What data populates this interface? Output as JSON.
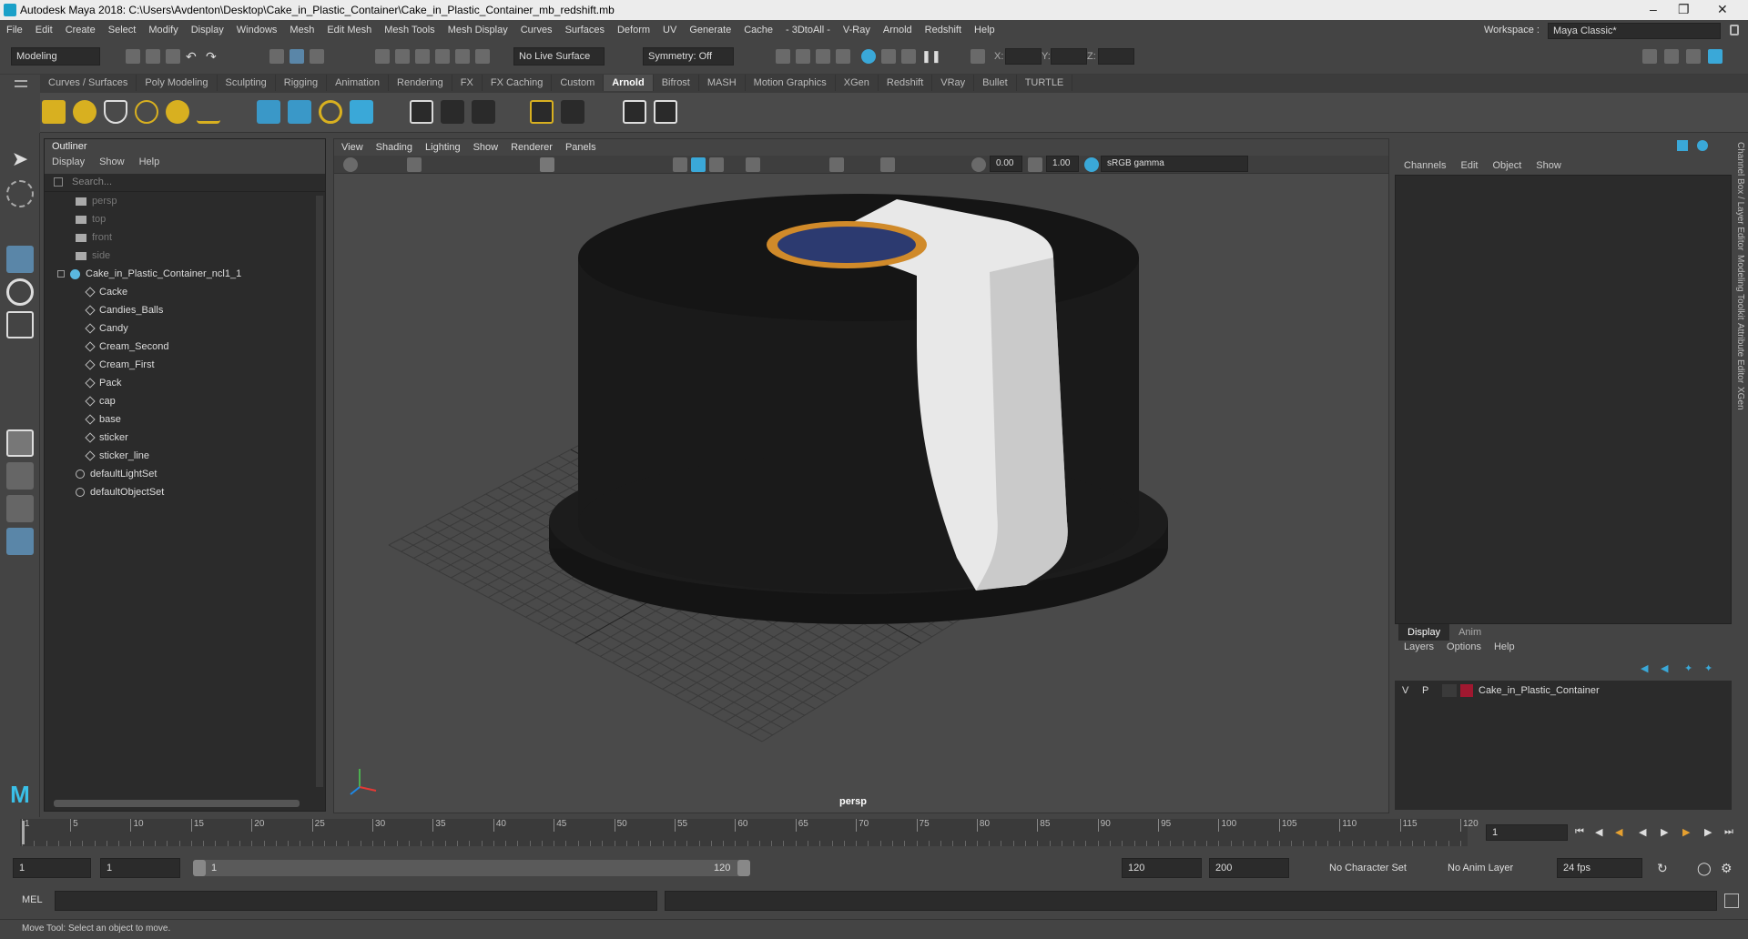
{
  "window": {
    "title": "Autodesk Maya 2018: C:\\Users\\Avdenton\\Desktop\\Cake_in_Plastic_Container\\Cake_in_Plastic_Container_mb_redshift.mb"
  },
  "menubar": [
    "File",
    "Edit",
    "Create",
    "Select",
    "Modify",
    "Display",
    "Windows",
    "Mesh",
    "Edit Mesh",
    "Mesh Tools",
    "Mesh Display",
    "Curves",
    "Surfaces",
    "Deform",
    "UV",
    "Generate",
    "Cache",
    "- 3DtoAll -",
    "V-Ray",
    "Arnold",
    "Redshift",
    "Help"
  ],
  "toolbar": {
    "mode": "Modeling",
    "live_surface": "No Live Surface",
    "symmetry": "Symmetry: Off",
    "x_label": "X:",
    "y_label": "Y:",
    "z_label": "Z:",
    "workspace_label": "Workspace :",
    "workspace_value": "Maya Classic*"
  },
  "shelf_tabs": [
    "Curves / Surfaces",
    "Poly Modeling",
    "Sculpting",
    "Rigging",
    "Animation",
    "Rendering",
    "FX",
    "FX Caching",
    "Custom",
    "Arnold",
    "Bifrost",
    "MASH",
    "Motion Graphics",
    "XGen",
    "Redshift",
    "VRay",
    "Bullet",
    "TURTLE"
  ],
  "active_shelf": "Arnold",
  "outliner": {
    "title": "Outliner",
    "menu": [
      "Display",
      "Show",
      "Help"
    ],
    "search_placeholder": "Search...",
    "cameras": [
      "persp",
      "top",
      "front",
      "side"
    ],
    "group": "Cake_in_Plastic_Container_ncl1_1",
    "children": [
      "Cacke",
      "Candies_Balls",
      "Candy",
      "Cream_Second",
      "Cream_First",
      "Pack",
      "cap",
      "base",
      "sticker",
      "sticker_line"
    ],
    "sets": [
      "defaultLightSet",
      "defaultObjectSet"
    ]
  },
  "viewport": {
    "menu": [
      "View",
      "Shading",
      "Lighting",
      "Show",
      "Renderer",
      "Panels"
    ],
    "near": "0.00",
    "far": "1.00",
    "color_space": "sRGB gamma",
    "camera_label": "persp"
  },
  "channel_box": {
    "menu": [
      "Channels",
      "Edit",
      "Object",
      "Show"
    ]
  },
  "layer_editor": {
    "tabs": [
      "Display",
      "Anim"
    ],
    "menu": [
      "Layers",
      "Options",
      "Help"
    ],
    "layer": {
      "v": "V",
      "p": "P",
      "name": "Cake_in_Plastic_Container",
      "color": "#a01830"
    }
  },
  "side_tabs": [
    "Channel Box / Layer Editor",
    "Modeling Toolkit",
    "Attribute Editor",
    "XGen"
  ],
  "timeline": {
    "ticks": [
      "1",
      "5",
      "10",
      "15",
      "20",
      "25",
      "30",
      "35",
      "40",
      "45",
      "50",
      "55",
      "60",
      "65",
      "70",
      "75",
      "80",
      "85",
      "90",
      "95",
      "100",
      "105",
      "110",
      "115",
      "120"
    ],
    "current_frame": "1"
  },
  "range": {
    "start": "1",
    "start2": "1",
    "slider_start": "1",
    "slider_end": "120",
    "end": "120",
    "end2": "200",
    "character_set": "No Character Set",
    "anim_layer": "No Anim Layer",
    "fps": "24 fps"
  },
  "mel": {
    "label": "MEL"
  },
  "status": "Move Tool: Select an object to move."
}
